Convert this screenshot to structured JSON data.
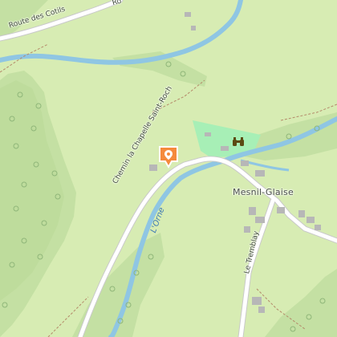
{
  "map": {
    "colors": {
      "background": "#d7ecb3",
      "forest": "#c4e0a3",
      "park": "#a7efb6",
      "road": "#ffffff",
      "road_casing": "#c9c9c9",
      "water": "#8fc6e3",
      "building": "#b7b7b7",
      "marker": "#f58a3c",
      "marker_border": "#ffffff"
    },
    "road_labels": {
      "route_des_cotils": "Route des Cotils",
      "route_top_fragment": "Ro",
      "chemin": "Chemin la Chapelle Saint-Roch",
      "le_tremblay": "Le Tremblay"
    },
    "place_labels": {
      "mesnil_glaise": "Mesnil-Glaise"
    },
    "water_labels": {
      "orne": "L'Orne"
    },
    "icons": {
      "location_marker": "map-pin-icon",
      "poi": "binoculars-icon"
    }
  }
}
